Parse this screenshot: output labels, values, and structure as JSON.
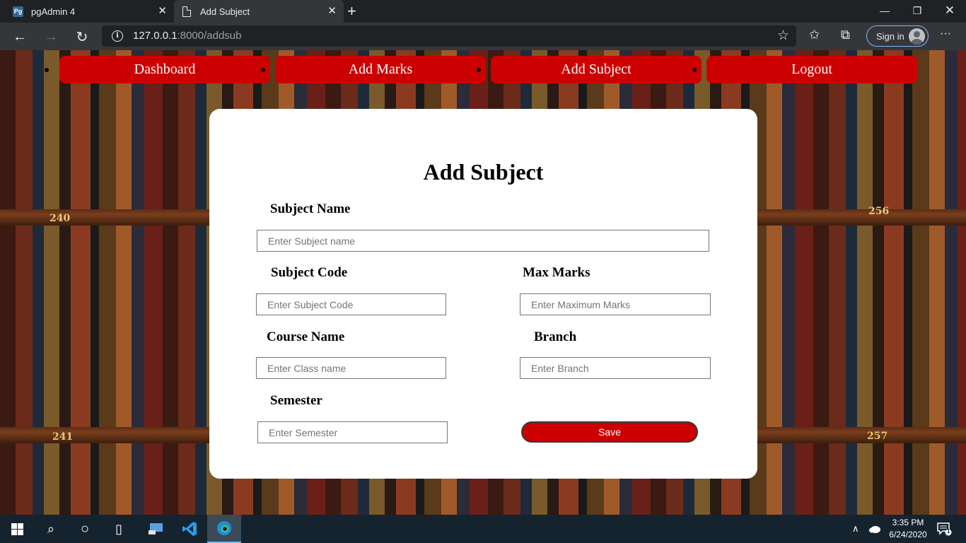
{
  "browser": {
    "tabs": [
      {
        "title": "pgAdmin 4",
        "favicon_text": "Pg"
      },
      {
        "title": "Add Subject"
      }
    ],
    "url_host": "127.0.0.1",
    "url_rest": ":8000/addsub",
    "signin_label": "Sign in",
    "menu_glyph": "···"
  },
  "background": {
    "shelf_labels": [
      "240",
      "256",
      "241",
      "257"
    ]
  },
  "nav": {
    "items": [
      "Dashboard",
      "Add Marks",
      "Add Subject",
      "Logout"
    ],
    "color": "#cc0000"
  },
  "form": {
    "title": "Add Subject",
    "subject_name": {
      "label": "Subject Name",
      "placeholder": "Enter Subject name"
    },
    "subject_code": {
      "label": "Subject Code",
      "placeholder": "Enter Subject Code"
    },
    "max_marks": {
      "label": "Max Marks",
      "placeholder": "Enter Maximum Marks"
    },
    "course_name": {
      "label": "Course Name",
      "placeholder": "Enter Class name"
    },
    "branch": {
      "label": "Branch",
      "placeholder": "Enter Branch"
    },
    "semester": {
      "label": "Semester",
      "placeholder": "Enter Semester"
    },
    "save_label": "Save"
  },
  "taskbar": {
    "time": "3:35 PM",
    "date": "6/24/2020",
    "notification_count": "1"
  }
}
